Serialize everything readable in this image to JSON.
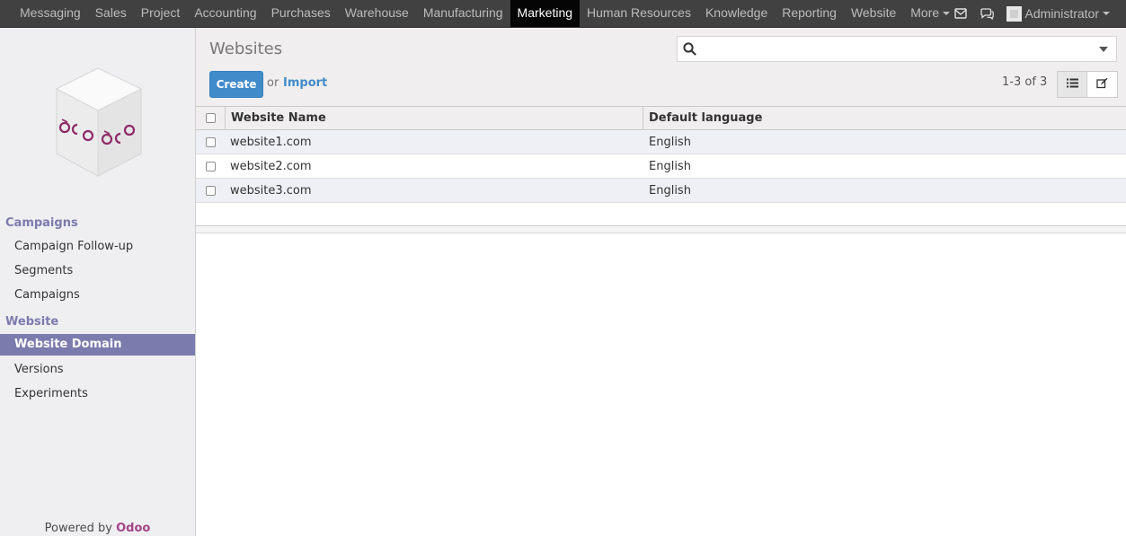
{
  "topbar": {
    "menu": [
      "Messaging",
      "Sales",
      "Project",
      "Accounting",
      "Purchases",
      "Warehouse",
      "Manufacturing",
      "Marketing",
      "Human Resources",
      "Knowledge",
      "Reporting",
      "Website",
      "More"
    ],
    "active": "Marketing",
    "user_name": "Administrator",
    "icons": [
      "envelope-icon",
      "chat-icon"
    ]
  },
  "sidebar": {
    "sections": [
      {
        "title": "Campaigns",
        "items": [
          "Campaign Follow-up",
          "Segments",
          "Campaigns"
        ]
      },
      {
        "title": "Website",
        "items": [
          "Website Domain",
          "Versions",
          "Experiments"
        ]
      }
    ],
    "active_item": "Website Domain",
    "powered_by": "Powered by",
    "powered_brand": "Odoo"
  },
  "control_panel": {
    "title": "Websites",
    "search_value": "",
    "create_label": "Create",
    "or_label": "or",
    "import_label": "Import",
    "pager": "1-3 of 3",
    "views": [
      "list-view-icon",
      "form-view-icon"
    ],
    "active_view": "list-view-icon"
  },
  "table": {
    "columns": [
      "Website Name",
      "Default language"
    ],
    "rows": [
      [
        "website1.com",
        "English"
      ],
      [
        "website2.com",
        "English"
      ],
      [
        "website3.com",
        "English"
      ]
    ]
  },
  "colors": {
    "topbar_bg": "#414141",
    "sidebar_accent": "#7c7bad",
    "primary_button": "#428bca",
    "brand": "#a24689"
  }
}
